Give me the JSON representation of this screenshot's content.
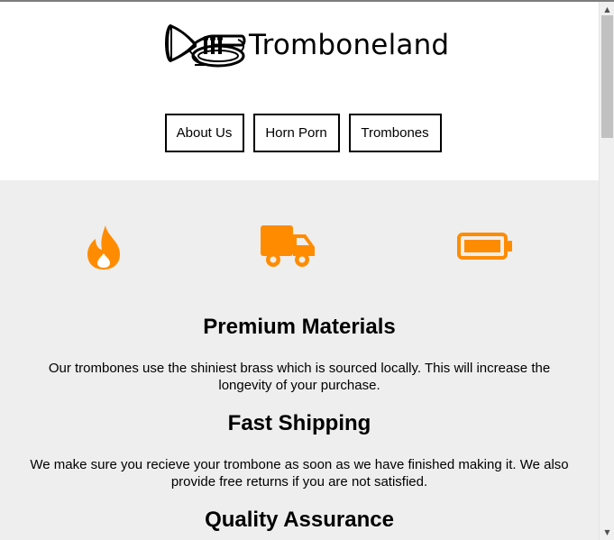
{
  "brand": {
    "name": "Tromboneland",
    "logo_icon": "tuba-icon"
  },
  "nav": {
    "items": [
      {
        "label": "About Us"
      },
      {
        "label": "Horn Porn"
      },
      {
        "label": "Trombones"
      }
    ]
  },
  "features": {
    "icons": [
      "fire-icon",
      "truck-icon",
      "battery-full-icon"
    ],
    "accent_color": "#ff8c00",
    "background_color": "#eeeeee",
    "items": [
      {
        "title": "Premium Materials",
        "text": "Our trombones use the shiniest brass which is sourced locally. This will increase the longevity of your purchase."
      },
      {
        "title": "Fast Shipping",
        "text": "We make sure you recieve your trombone as soon as we have finished making it. We also provide free returns if you are not satisfied."
      },
      {
        "title": "Quality Assurance",
        "text": ""
      }
    ]
  }
}
